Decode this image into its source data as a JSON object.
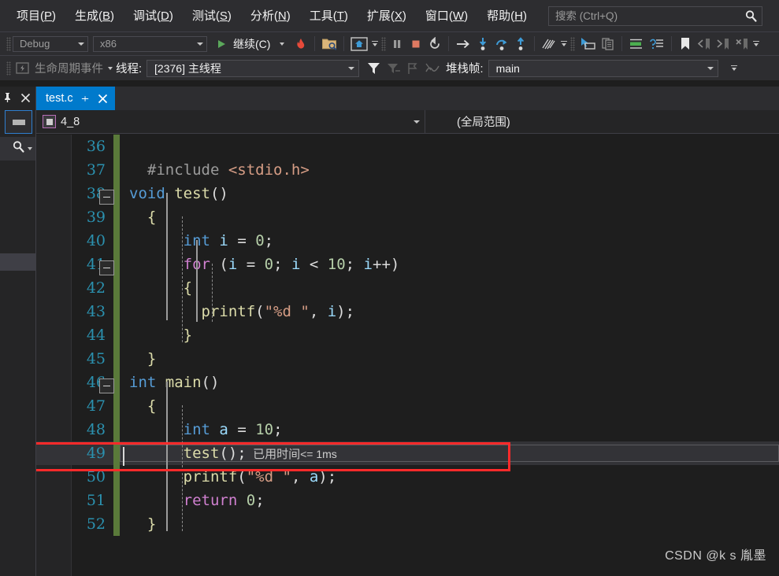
{
  "menu": {
    "items": [
      {
        "label": "项目(P)",
        "accel": "P"
      },
      {
        "label": "生成(B)",
        "accel": "B"
      },
      {
        "label": "调试(D)",
        "accel": "D"
      },
      {
        "label": "测试(S)",
        "accel": "S"
      },
      {
        "label": "分析(N)",
        "accel": "N"
      },
      {
        "label": "工具(T)",
        "accel": "T"
      },
      {
        "label": "扩展(X)",
        "accel": "X"
      },
      {
        "label": "窗口(W)",
        "accel": "W"
      },
      {
        "label": "帮助(H)",
        "accel": "H"
      }
    ]
  },
  "search": {
    "placeholder": "搜索 (Ctrl+Q)",
    "value": "",
    "icon": "search-icon"
  },
  "toolbar": {
    "configuration": "Debug",
    "platform": "x86",
    "continue_label": "继续(C)",
    "icons": [
      "run-continue-icon",
      "hot-reload-icon",
      "open-folder-icon",
      "home-icon",
      "pause-icon",
      "stop-icon",
      "restart-icon",
      "show-next-statement-icon",
      "step-into-icon",
      "step-over-icon",
      "step-out-icon",
      "diagnostics-icon",
      "pointer-select-icon",
      "copy-icon",
      "comment-icon",
      "uncomment-icon",
      "bookmark-icon",
      "prev-bookmark-icon",
      "next-bookmark-icon",
      "clear-bookmark-icon"
    ]
  },
  "debugbar": {
    "lifecycle_label": "生命周期事件",
    "thread_label": "线程:",
    "thread_value": "[2376] 主线程",
    "frame_label": "堆栈帧:",
    "frame_value": "main",
    "icons": [
      "lifecycle-icon",
      "filter-icon",
      "filter-clear-icon",
      "flag-icon",
      "thread-graph-icon"
    ]
  },
  "leftdock": {
    "pin_icon": "pin-icon",
    "close_icon": "close-icon",
    "toolbox_label": "toolbox-icon",
    "search_icon": "search-icon"
  },
  "tab": {
    "title": "test.c",
    "pin_icon": "pin-icon",
    "close_icon": "close-icon"
  },
  "navbar": {
    "left_value": "4_8",
    "right_value": "(全局范围)"
  },
  "editor": {
    "first_line": 36,
    "exec_line": 49,
    "elapsed_text": "已用时间",
    "elapsed_value": "<= 1ms",
    "lines": [
      {
        "n": 36,
        "tokens": []
      },
      {
        "n": 37,
        "tokens": [
          {
            "t": "  ",
            "c": "pl"
          },
          {
            "t": "#include",
            "c": "pre"
          },
          {
            "t": " ",
            "c": "pl"
          },
          {
            "t": "<stdio.h>",
            "c": "inc"
          }
        ]
      },
      {
        "n": 38,
        "fold": true,
        "tokens": [
          {
            "t": "void",
            "c": "kw"
          },
          {
            "t": " ",
            "c": "pl"
          },
          {
            "t": "test",
            "c": "fn"
          },
          {
            "t": "()",
            "c": "pl"
          }
        ]
      },
      {
        "n": 39,
        "tokens": [
          {
            "t": "  {",
            "c": "brace"
          }
        ]
      },
      {
        "n": 40,
        "tokens": [
          {
            "t": "      ",
            "c": "pl"
          },
          {
            "t": "int",
            "c": "kw"
          },
          {
            "t": " ",
            "c": "pl"
          },
          {
            "t": "i",
            "c": "var"
          },
          {
            "t": " = ",
            "c": "pl"
          },
          {
            "t": "0",
            "c": "num"
          },
          {
            "t": ";",
            "c": "pl"
          }
        ]
      },
      {
        "n": 41,
        "fold": true,
        "tokens": [
          {
            "t": "      ",
            "c": "pl"
          },
          {
            "t": "for",
            "c": "kw2"
          },
          {
            "t": " (",
            "c": "pl"
          },
          {
            "t": "i",
            "c": "var"
          },
          {
            "t": " = ",
            "c": "pl"
          },
          {
            "t": "0",
            "c": "num"
          },
          {
            "t": "; ",
            "c": "pl"
          },
          {
            "t": "i",
            "c": "var"
          },
          {
            "t": " < ",
            "c": "pl"
          },
          {
            "t": "10",
            "c": "num"
          },
          {
            "t": "; ",
            "c": "pl"
          },
          {
            "t": "i",
            "c": "var"
          },
          {
            "t": "++)",
            "c": "pl"
          }
        ]
      },
      {
        "n": 42,
        "tokens": [
          {
            "t": "      {",
            "c": "brace"
          }
        ]
      },
      {
        "n": 43,
        "tokens": [
          {
            "t": "        ",
            "c": "pl"
          },
          {
            "t": "printf",
            "c": "fn"
          },
          {
            "t": "(",
            "c": "pl"
          },
          {
            "t": "\"%d \"",
            "c": "str"
          },
          {
            "t": ", ",
            "c": "pl"
          },
          {
            "t": "i",
            "c": "var"
          },
          {
            "t": ");",
            "c": "pl"
          }
        ]
      },
      {
        "n": 44,
        "tokens": [
          {
            "t": "      }",
            "c": "brace"
          }
        ]
      },
      {
        "n": 45,
        "tokens": [
          {
            "t": "  }",
            "c": "brace"
          }
        ]
      },
      {
        "n": 46,
        "fold": true,
        "tokens": [
          {
            "t": "int",
            "c": "kw"
          },
          {
            "t": " ",
            "c": "pl"
          },
          {
            "t": "main",
            "c": "fn"
          },
          {
            "t": "()",
            "c": "pl"
          }
        ]
      },
      {
        "n": 47,
        "tokens": [
          {
            "t": "  {",
            "c": "brace"
          }
        ]
      },
      {
        "n": 48,
        "tokens": [
          {
            "t": "      ",
            "c": "pl"
          },
          {
            "t": "int",
            "c": "kw"
          },
          {
            "t": " ",
            "c": "pl"
          },
          {
            "t": "a",
            "c": "var"
          },
          {
            "t": " = ",
            "c": "pl"
          },
          {
            "t": "10",
            "c": "num"
          },
          {
            "t": ";",
            "c": "pl"
          }
        ]
      },
      {
        "n": 49,
        "exec": true,
        "tokens": [
          {
            "t": "      ",
            "c": "pl"
          },
          {
            "t": "test",
            "c": "fn"
          },
          {
            "t": "();",
            "c": "pl"
          }
        ]
      },
      {
        "n": 50,
        "tokens": [
          {
            "t": "      ",
            "c": "pl"
          },
          {
            "t": "printf",
            "c": "fn"
          },
          {
            "t": "(",
            "c": "pl"
          },
          {
            "t": "\"%d \"",
            "c": "str"
          },
          {
            "t": ", ",
            "c": "pl"
          },
          {
            "t": "a",
            "c": "var"
          },
          {
            "t": ");",
            "c": "pl"
          }
        ]
      },
      {
        "n": 51,
        "tokens": [
          {
            "t": "      ",
            "c": "pl"
          },
          {
            "t": "return",
            "c": "kw2"
          },
          {
            "t": " ",
            "c": "pl"
          },
          {
            "t": "0",
            "c": "num"
          },
          {
            "t": ";",
            "c": "pl"
          }
        ]
      },
      {
        "n": 52,
        "tokens": [
          {
            "t": "  }",
            "c": "brace"
          }
        ]
      }
    ]
  },
  "annotation": {
    "color": "#ff2a2a"
  },
  "watermark": {
    "text": "CSDN @k s 胤墨"
  },
  "colors": {
    "accent": "#007acc",
    "chrome": "#2d2d30",
    "editor_bg": "#1e1e1e",
    "linenum": "#2b91af",
    "changed_bar": "#5a7a3a",
    "exec_row": "#333337",
    "annotation_red": "#ff2a2a"
  }
}
